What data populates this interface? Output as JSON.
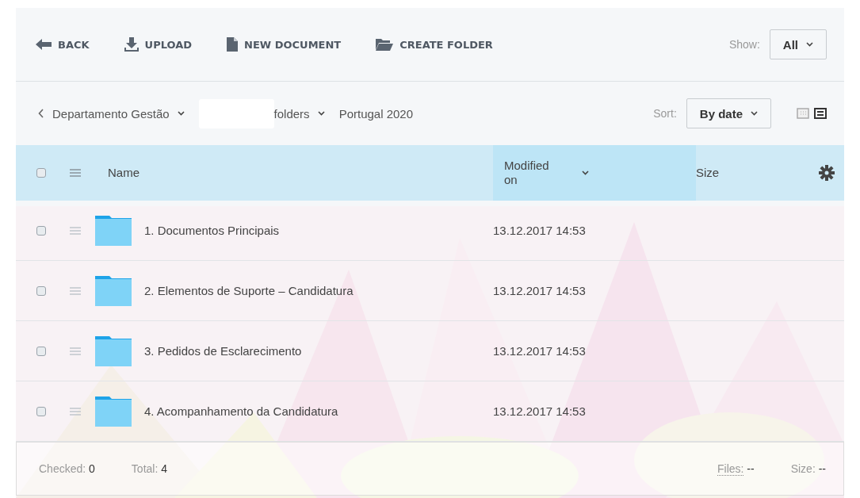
{
  "toolbar": {
    "actions": [
      {
        "label": "BACK",
        "kind": "back"
      },
      {
        "label": "UPLOAD",
        "kind": "upload"
      },
      {
        "label": "NEW DOCUMENT",
        "kind": "document"
      },
      {
        "label": "CREATE FOLDER",
        "kind": "folder"
      }
    ],
    "show": {
      "label": "Show:",
      "value": "All"
    }
  },
  "breadcrumb": {
    "items": [
      {
        "label": "Departamento Gestão",
        "dropdown": true,
        "redacted_after": true
      },
      {
        "label": "folders",
        "dropdown": true,
        "redacted_after": false
      },
      {
        "label": "Portugal 2020",
        "dropdown": false,
        "redacted_after": false
      }
    ],
    "sort": {
      "label": "Sort:",
      "value": "By date"
    },
    "views": [
      {
        "kind": "grid",
        "selected": false
      },
      {
        "kind": "list",
        "selected": true
      }
    ]
  },
  "table": {
    "header_checked": false,
    "columns": [
      {
        "label": "Name",
        "sorted": false
      },
      {
        "label": "Modified on",
        "sorted": true
      },
      {
        "label": "Size",
        "sorted": false
      }
    ],
    "rows": [
      {
        "name": "1. Documentos Principais",
        "modified": "13.12.2017 14:53",
        "checked": false
      },
      {
        "name": "2. Elementos de Suporte – Candidatura",
        "modified": "13.12.2017 14:53",
        "checked": false
      },
      {
        "name": "3. Pedidos de Esclarecimento",
        "modified": "13.12.2017 14:53",
        "checked": false
      },
      {
        "name": "4. Acompanhamento da Candidatura",
        "modified": "13.12.2017 14:53",
        "checked": false
      }
    ]
  },
  "footer": {
    "checked_label": "Checked:",
    "checked_value": "0",
    "total_label": "Total:",
    "total_value": "4",
    "files_label": "Files:",
    "files_value": "--",
    "size_label": "Size:",
    "size_value": "--"
  }
}
